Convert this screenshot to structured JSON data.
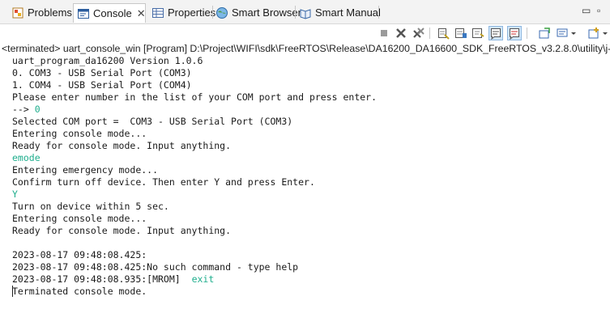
{
  "tabs": [
    {
      "label": "Problems",
      "icon": "problems-icon",
      "active": false
    },
    {
      "label": "Console",
      "icon": "console-icon",
      "active": true,
      "close": "✕"
    },
    {
      "label": "Properties",
      "icon": "properties-icon",
      "active": false
    },
    {
      "label": "Smart Browser",
      "icon": "smart-browser-icon",
      "active": false
    },
    {
      "label": "Smart Manual",
      "icon": "smart-manual-icon",
      "active": false
    }
  ],
  "window_controls": {
    "minimize": "▭",
    "maximize": "▫"
  },
  "console_path": "<terminated> uart_console_win [Program] D:\\Project\\WIFI\\sdk\\FreeRTOS\\Release\\DA16200_DA16600_SDK_FreeRTOS_v3.2.8.0\\utility\\j-link\\scri",
  "console_lines": [
    {
      "text": "uart_program_da16200 Version 1.0.6",
      "type": "output"
    },
    {
      "text": "0. COM3 - USB Serial Port (COM3)",
      "type": "output"
    },
    {
      "text": "1. COM4 - USB Serial Port (COM4)",
      "type": "output"
    },
    {
      "text": "Please enter number in the list of your COM port and press enter.",
      "type": "output"
    },
    {
      "prefix": "--> ",
      "text": "0",
      "type": "mixed"
    },
    {
      "text": "Selected COM port =  COM3 - USB Serial Port (COM3)",
      "type": "output"
    },
    {
      "text": "Entering console mode...",
      "type": "output"
    },
    {
      "text": "Ready for console mode. Input anything.",
      "type": "output"
    },
    {
      "text": "emode",
      "type": "input"
    },
    {
      "text": "Entering emergency mode...",
      "type": "output"
    },
    {
      "text": "Confirm turn off device. Then enter Y and press Enter.",
      "type": "output"
    },
    {
      "text": "Y",
      "type": "input"
    },
    {
      "text": "Turn on device within 5 sec.",
      "type": "output"
    },
    {
      "text": "Entering console mode...",
      "type": "output"
    },
    {
      "text": "Ready for console mode. Input anything.",
      "type": "output"
    },
    {
      "text": "",
      "type": "output"
    },
    {
      "text": "2023-08-17 09:48:08.425:",
      "type": "output"
    },
    {
      "text": "2023-08-17 09:48:08.425:No such command - type help",
      "type": "output"
    },
    {
      "prefix": "2023-08-17 09:48:08.935:[MROM]  ",
      "text": "exit",
      "type": "mixed"
    },
    {
      "text": "Terminated console mode.",
      "type": "output"
    }
  ],
  "colors": {
    "input_text": "#1fae8d",
    "output_text": "#1a1a1a",
    "tab_bar_bg": "#f3f3f3"
  },
  "toolbar_icons": [
    "terminate-icon",
    "remove-launch-icon",
    "remove-all-terminated-icon",
    "clear-console-icon",
    "scroll-lock-icon",
    "word-wrap-icon",
    "show-on-stdout-icon",
    "show-on-stderr-icon",
    "pin-console-icon",
    "display-console-icon",
    "open-console-icon"
  ]
}
